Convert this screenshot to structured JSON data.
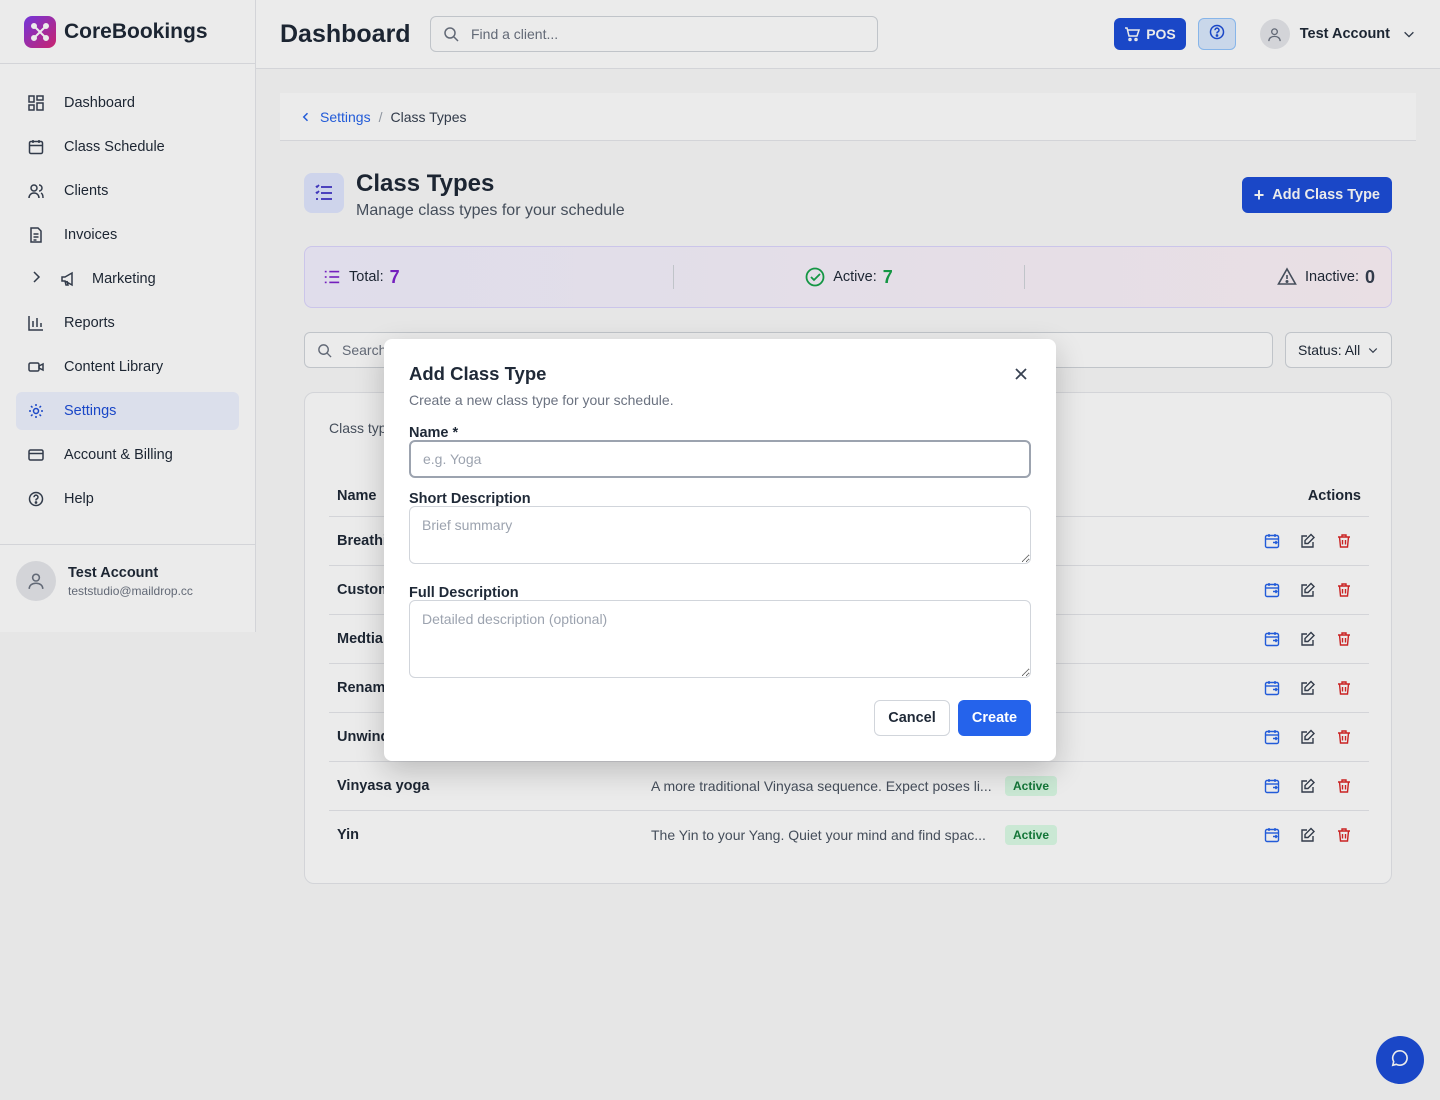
{
  "app": {
    "name": "CoreBookings",
    "brand_color": "#7c3aed",
    "accent": "#1d4ed8"
  },
  "sidebar": {
    "items": [
      {
        "label": "Dashboard",
        "icon": "grid-icon"
      },
      {
        "label": "Class Schedule",
        "icon": "calendar-icon"
      },
      {
        "label": "Clients",
        "icon": "users-icon"
      },
      {
        "label": "Invoices",
        "icon": "document-icon"
      },
      {
        "label": "Marketing",
        "icon": "megaphone-icon"
      },
      {
        "label": "Reports",
        "icon": "bar-chart-icon"
      },
      {
        "label": "Content Library",
        "icon": "video-icon"
      },
      {
        "label": "Settings",
        "icon": "gear-icon",
        "active": true
      },
      {
        "label": "Account & Billing",
        "icon": "credit-card-icon"
      },
      {
        "label": "Help",
        "icon": "help-circle-icon"
      }
    ],
    "user": {
      "name": "Test Account",
      "email": "teststudio@maildrop.cc"
    }
  },
  "header": {
    "title": "Dashboard",
    "search_placeholder": "Find a client...",
    "pos_label": "POS",
    "account_name": "Test Account"
  },
  "breadcrumb": {
    "parent": "Settings",
    "current": "Class Types"
  },
  "page": {
    "title": "Class Types",
    "subtitle": "Manage class types for your schedule",
    "add_button": "Add Class Type"
  },
  "stats": {
    "total_label": "Total:",
    "total": "7",
    "active_label": "Active:",
    "active": "7",
    "inactive_label": "Inactive:",
    "inactive": "0"
  },
  "filters": {
    "search_placeholder": "Search",
    "status": "Status: All"
  },
  "table": {
    "caption": "Class typ",
    "headers": {
      "name": "Name",
      "actions": "Actions"
    },
    "rows": [
      {
        "name": "Breathi",
        "description": "",
        "status": ""
      },
      {
        "name": "Custom",
        "description": "",
        "status": ""
      },
      {
        "name": "Medtia",
        "description": "",
        "status": ""
      },
      {
        "name": "Rename",
        "description": "",
        "status": ""
      },
      {
        "name": "Unwind",
        "description": "",
        "status": ""
      },
      {
        "name": "Vinyasa yoga",
        "description": "A more traditional Vinyasa sequence. Expect poses li...",
        "status": "Active"
      },
      {
        "name": "Yin",
        "description": "The Yin to your Yang. Quiet your mind and find spac...",
        "status": "Active"
      }
    ]
  },
  "modal": {
    "title": "Add Class Type",
    "subtitle": "Create a new class type for your schedule.",
    "name_label": "Name *",
    "name_placeholder": "e.g. Yoga",
    "short_label": "Short Description",
    "short_placeholder": "Brief summary",
    "full_label": "Full Description",
    "full_placeholder": "Detailed description (optional)",
    "cancel": "Cancel",
    "create": "Create"
  }
}
